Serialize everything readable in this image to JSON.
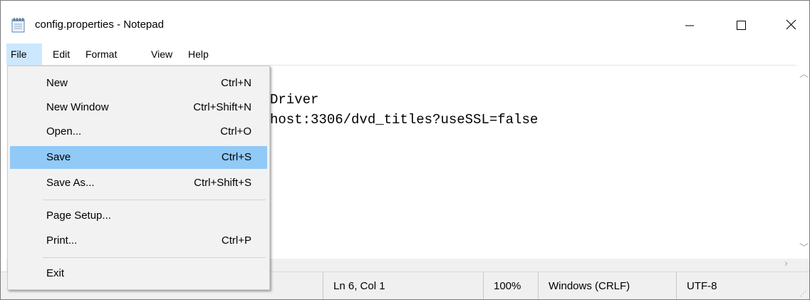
{
  "window": {
    "title": "config.properties - Notepad",
    "controls": {
      "minimize": "minimize-icon",
      "maximize": "maximize-icon",
      "close": "close-icon"
    }
  },
  "menubar": {
    "items": [
      {
        "label": "File",
        "active": true
      },
      {
        "label": "Edit"
      },
      {
        "label": "Format"
      },
      {
        "label": "View"
      },
      {
        "label": "Help"
      }
    ]
  },
  "file_menu": {
    "items": [
      {
        "label": "New",
        "shortcut": "Ctrl+N"
      },
      {
        "label": "New Window",
        "shortcut": "Ctrl+Shift+N"
      },
      {
        "label": "Open...",
        "shortcut": "Ctrl+O"
      },
      {
        "label": "Save",
        "shortcut": "Ctrl+S",
        "highlighted": true
      },
      {
        "label": "Save As...",
        "shortcut": "Ctrl+Shift+S"
      },
      {
        "label": "Page Setup...",
        "shortcut": ""
      },
      {
        "label": "Print...",
        "shortcut": "Ctrl+P"
      },
      {
        "label": "Exit",
        "shortcut": ""
      }
    ]
  },
  "editor": {
    "visible_lines": [
      "Driver",
      "host:3306/dvd_titles?useSSL=false"
    ]
  },
  "statusbar": {
    "position": "Ln 6, Col 1",
    "zoom": "100%",
    "line_ending": "Windows (CRLF)",
    "encoding": "UTF-8"
  },
  "colors": {
    "menu_highlight": "#91c9f7",
    "menubar_active": "#cce8ff",
    "dropdown_bg": "#f2f2f2",
    "statusbar_bg": "#f0f0f0"
  }
}
